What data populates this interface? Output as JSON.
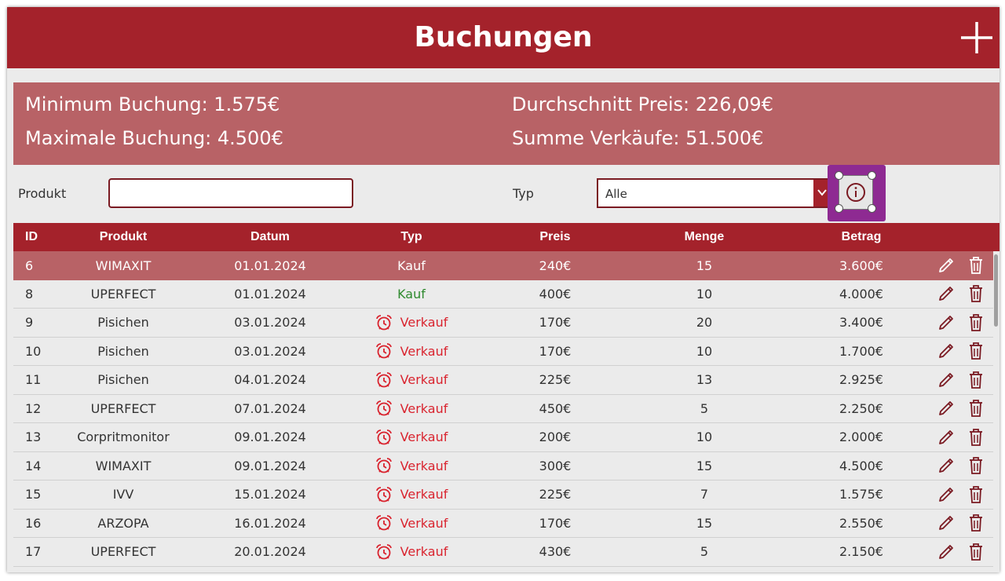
{
  "header": {
    "title": "Buchungen",
    "add_icon": "plus-icon"
  },
  "stats": {
    "min": "Minimum Buchung: 1.575€",
    "max": "Maximale Buchung: 4.500€",
    "avg": "Durchschnitt Preis: 226,09€",
    "sum": "Summe Verkäufe: 51.500€"
  },
  "filters": {
    "produkt_label": "Produkt",
    "produkt_value": "",
    "typ_label": "Typ",
    "typ_value": "Alle"
  },
  "table": {
    "headers": {
      "id": "ID",
      "produkt": "Produkt",
      "datum": "Datum",
      "typ": "Typ",
      "preis": "Preis",
      "menge": "Menge",
      "betrag": "Betrag"
    },
    "rows": [
      {
        "id": "6",
        "produkt": "WIMAXIT",
        "datum": "01.01.2024",
        "typ": "Kauf",
        "preis": "240€",
        "menge": "15",
        "betrag": "3.600€"
      },
      {
        "id": "8",
        "produkt": "UPERFECT",
        "datum": "01.01.2024",
        "typ": "Kauf",
        "preis": "400€",
        "menge": "10",
        "betrag": "4.000€"
      },
      {
        "id": "9",
        "produkt": "Pisichen",
        "datum": "03.01.2024",
        "typ": "Verkauf",
        "preis": "170€",
        "menge": "20",
        "betrag": "3.400€"
      },
      {
        "id": "10",
        "produkt": "Pisichen",
        "datum": "03.01.2024",
        "typ": "Verkauf",
        "preis": "170€",
        "menge": "10",
        "betrag": "1.700€"
      },
      {
        "id": "11",
        "produkt": "Pisichen",
        "datum": "04.01.2024",
        "typ": "Verkauf",
        "preis": "225€",
        "menge": "13",
        "betrag": "2.925€"
      },
      {
        "id": "12",
        "produkt": "UPERFECT",
        "datum": "07.01.2024",
        "typ": "Verkauf",
        "preis": "450€",
        "menge": "5",
        "betrag": "2.250€"
      },
      {
        "id": "13",
        "produkt": "Corpritmonitor",
        "datum": "09.01.2024",
        "typ": "Verkauf",
        "preis": "200€",
        "menge": "10",
        "betrag": "2.000€"
      },
      {
        "id": "14",
        "produkt": "WIMAXIT",
        "datum": "09.01.2024",
        "typ": "Verkauf",
        "preis": "300€",
        "menge": "15",
        "betrag": "4.500€"
      },
      {
        "id": "15",
        "produkt": "IVV",
        "datum": "15.01.2024",
        "typ": "Verkauf",
        "preis": "225€",
        "menge": "7",
        "betrag": "1.575€"
      },
      {
        "id": "16",
        "produkt": "ARZOPA",
        "datum": "16.01.2024",
        "typ": "Verkauf",
        "preis": "170€",
        "menge": "15",
        "betrag": "2.550€"
      },
      {
        "id": "17",
        "produkt": "UPERFECT",
        "datum": "20.01.2024",
        "typ": "Verkauf",
        "preis": "430€",
        "menge": "5",
        "betrag": "2.150€"
      }
    ],
    "selected_index": 0
  },
  "colors": {
    "primary": "#a4222b",
    "stats_bg": "#b86266",
    "kauf": "#2f8a2f",
    "verkauf": "#d9232e",
    "selection": "#8e2a92"
  },
  "icons": {
    "verkauf": "alarm-clock-icon",
    "edit": "pencil-icon",
    "delete": "trash-icon",
    "info": "info-icon",
    "dropdown": "chevron-down-icon"
  }
}
